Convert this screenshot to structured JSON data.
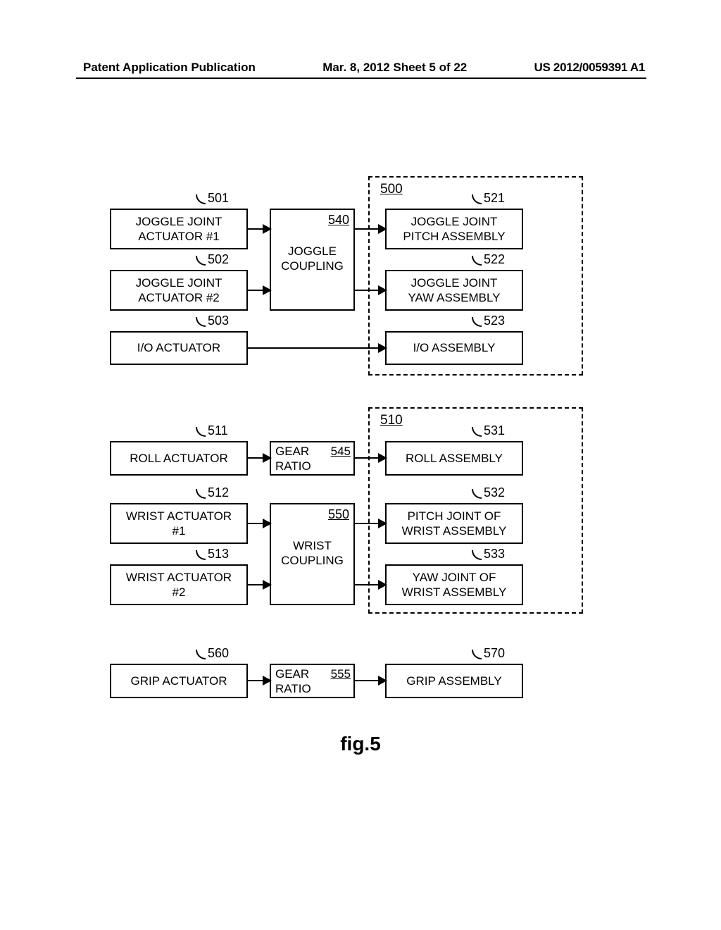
{
  "header": {
    "left": "Patent Application Publication",
    "center": "Mar. 8, 2012  Sheet 5 of 22",
    "right": "US 2012/0059391 A1"
  },
  "figure_caption": "fig.5",
  "refs": {
    "r500": "500",
    "r501": "501",
    "r502": "502",
    "r503": "503",
    "r510": "510",
    "r511": "511",
    "r512": "512",
    "r513": "513",
    "r521": "521",
    "r522": "522",
    "r523": "523",
    "r531": "531",
    "r532": "532",
    "r533": "533",
    "r540": "540",
    "r545": "545",
    "r550": "550",
    "r555": "555",
    "r560": "560",
    "r570": "570"
  },
  "labels": {
    "b501": "JOGGLE JOINT\nACTUATOR #1",
    "b502": "JOGGLE JOINT\nACTUATOR #2",
    "b503": "I/O ACTUATOR",
    "b540a": "JOGGLE",
    "b540b": "COUPLING",
    "b521": "JOGGLE JOINT\nPITCH ASSEMBLY",
    "b522": "JOGGLE JOINT\nYAW ASSEMBLY",
    "b523": "I/O ASSEMBLY",
    "b511": "ROLL ACTUATOR",
    "b512": "WRIST ACTUATOR\n#1",
    "b513": "WRIST ACTUATOR\n#2",
    "b545a": "GEAR",
    "b545b": "RATIO",
    "b550a": "WRIST",
    "b550b": "COUPLING",
    "b531": "ROLL ASSEMBLY",
    "b532": "PITCH JOINT OF\nWRIST ASSEMBLY",
    "b533": "YAW JOINT OF\nWRIST ASSEMBLY",
    "b560": "GRIP ACTUATOR",
    "b555a": "GEAR",
    "b555b": "RATIO",
    "b570": "GRIP ASSEMBLY"
  }
}
